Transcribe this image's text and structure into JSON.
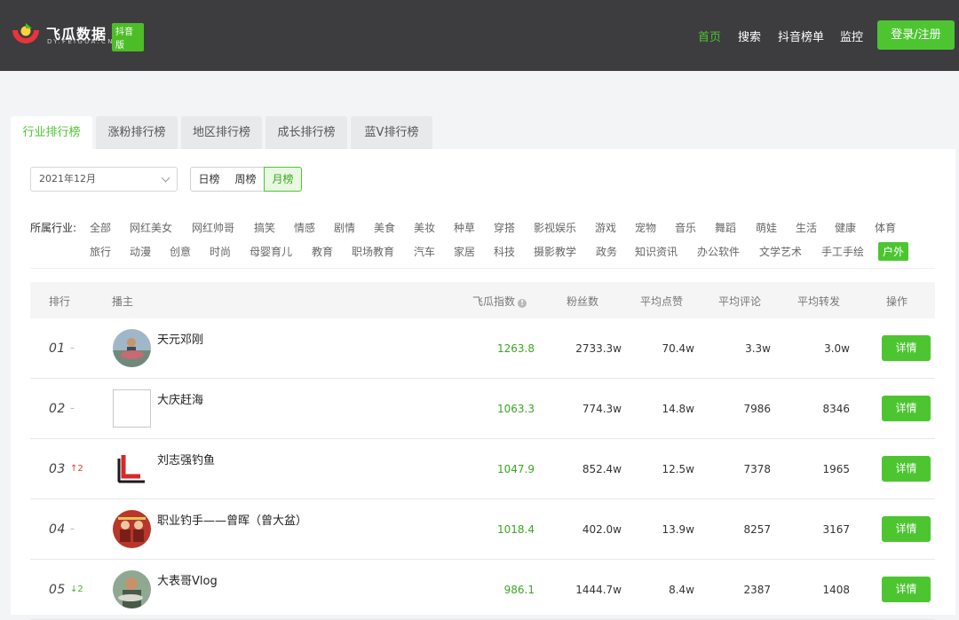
{
  "brand": {
    "name_cn": "飞瓜数据",
    "badge": "抖音版",
    "domain": "DY.FEIGUA.CN",
    "accent": "#4dc531"
  },
  "nav": {
    "items": [
      "首页",
      "搜索",
      "抖音榜单",
      "监控"
    ],
    "active": "首页",
    "login_label": "登录/注册"
  },
  "tabs": [
    "行业排行榜",
    "涨粉排行榜",
    "地区排行榜",
    "成长排行榜",
    "蓝V排行榜"
  ],
  "filters": {
    "date_value": "2021年12月",
    "periods": [
      "日榜",
      "周榜",
      "月榜"
    ],
    "active_period": "月榜",
    "industry_label": "所属行业:",
    "industries_row1": [
      "全部",
      "网红美女",
      "网红帅哥",
      "搞笑",
      "情感",
      "剧情",
      "美食",
      "美妆",
      "种草",
      "穿搭",
      "影视娱乐",
      "游戏",
      "宠物",
      "音乐",
      "舞蹈",
      "萌娃",
      "生活",
      "健康",
      "体育"
    ],
    "industries_row2": [
      "旅行",
      "动漫",
      "创意",
      "时尚",
      "母婴育儿",
      "教育",
      "职场教育",
      "汽车",
      "家居",
      "科技",
      "摄影教学",
      "政务",
      "知识资讯",
      "办公软件",
      "文学艺术",
      "手工手绘",
      "户外"
    ],
    "active_industry": "户外"
  },
  "table": {
    "headers": {
      "rank": "排行",
      "anchor": "播主",
      "index": "飞瓜指数",
      "index_icon": "info-icon",
      "fans": "粉丝数",
      "likes": "平均点赞",
      "comments": "平均评论",
      "shares": "平均转发",
      "action": "操作"
    },
    "rows": [
      {
        "rank": "01",
        "trend": "–",
        "trend_type": "flat",
        "name": "天元邓刚",
        "index": "1263.8",
        "fans": "2733.3w",
        "likes": "70.4w",
        "comments": "3.3w",
        "shares": "3.0w",
        "action": "详情"
      },
      {
        "rank": "02",
        "trend": "–",
        "trend_type": "flat",
        "name": "大庆赶海",
        "index": "1063.3",
        "fans": "774.3w",
        "likes": "14.8w",
        "comments": "7986",
        "shares": "8346",
        "action": "详情"
      },
      {
        "rank": "03",
        "trend": "↑2",
        "trend_type": "up",
        "name": "刘志强钓鱼",
        "index": "1047.9",
        "fans": "852.4w",
        "likes": "12.5w",
        "comments": "7378",
        "shares": "1965",
        "action": "详情"
      },
      {
        "rank": "04",
        "trend": "–",
        "trend_type": "flat",
        "name": "职业钓手——曾晖（曾大盆）",
        "index": "1018.4",
        "fans": "402.0w",
        "likes": "13.9w",
        "comments": "8257",
        "shares": "3167",
        "action": "详情"
      },
      {
        "rank": "05",
        "trend": "↓2",
        "trend_type": "down",
        "name": "大表哥Vlog",
        "index": "986.1",
        "fans": "1444.7w",
        "likes": "8.4w",
        "comments": "2387",
        "shares": "1408",
        "action": "详情"
      }
    ]
  }
}
